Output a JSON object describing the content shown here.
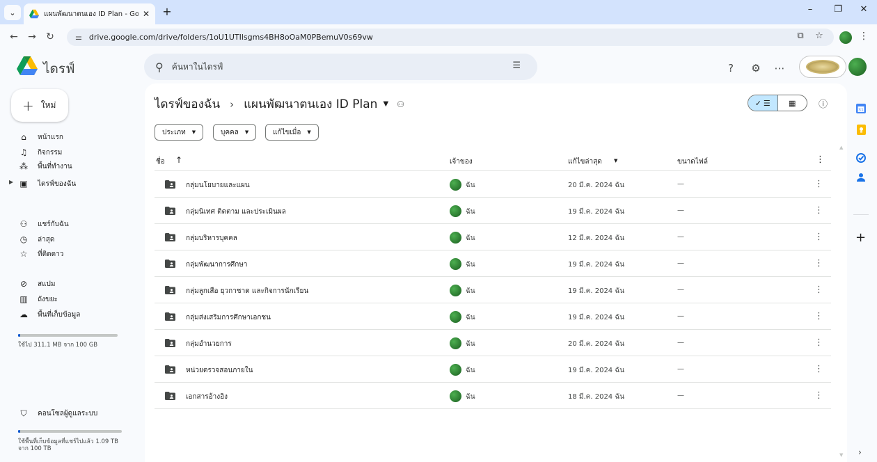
{
  "browser": {
    "tab_title": "แผนพัฒนาตนเอง ID Plan - Google",
    "url": "drive.google.com/drive/folders/1oU1UTIlsgms4BH8oOaM0PBemuV0s69vw"
  },
  "header": {
    "brand": "ไดรฟ์",
    "search_placeholder": "ค้นหาในไดรฟ์"
  },
  "sidebar": {
    "new_label": "ใหม่",
    "items": [
      {
        "label": "หน้าแรก",
        "icon": "home-icon"
      },
      {
        "label": "กิจกรรม",
        "icon": "bell-icon"
      },
      {
        "label": "พื้นที่ทำงาน",
        "icon": "workspace-icon"
      },
      {
        "label": "ไดรฟ์ของฉัน",
        "icon": "my-drive-icon"
      },
      {
        "label": "แชร์กับฉัน",
        "icon": "people-icon"
      },
      {
        "label": "ล่าสุด",
        "icon": "clock-icon"
      },
      {
        "label": "ที่ติดดาว",
        "icon": "star-icon"
      },
      {
        "label": "สแปม",
        "icon": "spam-icon"
      },
      {
        "label": "ถังขยะ",
        "icon": "trash-icon"
      },
      {
        "label": "พื้นที่เก็บข้อมูล",
        "icon": "cloud-icon"
      }
    ],
    "storage_text": "ใช้ไป 311.1 MB จาก 100 GB",
    "storage_fraction": 0.003,
    "admin_label": "คอนโซลผู้ดูแลระบบ",
    "shared_storage_text_line1": "ใช้พื้นที่เก็บข้อมูลที่แชร์ไปแล้ว 1.09 TB",
    "shared_storage_text_line2": "จาก 100 TB",
    "shared_storage_fraction": 0.011
  },
  "main": {
    "breadcrumb_root": "ไดรฟ์ของฉัน",
    "breadcrumb_current": "แผนพัฒนาตนเอง ID Plan",
    "filters": [
      "ประเภท",
      "บุคคล",
      "แก้ไขเมื่อ"
    ],
    "columns": {
      "name": "ชื่อ",
      "owner": "เจ้าของ",
      "modified": "แก้ไขล่าสุด",
      "size": "ขนาดไฟล์"
    },
    "rows": [
      {
        "name": "กลุ่มนโยบายและแผน",
        "owner": "ฉัน",
        "modified": "20 มี.ค. 2024 ฉัน",
        "size": "—"
      },
      {
        "name": "กลุ่มนิเทศ ติดตาม และประเมินผล",
        "owner": "ฉัน",
        "modified": "19 มี.ค. 2024 ฉัน",
        "size": "—"
      },
      {
        "name": "กลุ่มบริหารบุคคล",
        "owner": "ฉัน",
        "modified": "12 มี.ค. 2024 ฉัน",
        "size": "—"
      },
      {
        "name": "กลุ่มพัฒนาการศึกษา",
        "owner": "ฉัน",
        "modified": "19 มี.ค. 2024 ฉัน",
        "size": "—"
      },
      {
        "name": "กลุ่มลูกเสือ ยุวกาชาด และกิจการนักเรียน",
        "owner": "ฉัน",
        "modified": "19 มี.ค. 2024 ฉัน",
        "size": "—"
      },
      {
        "name": "กลุ่มส่งเสริมการศึกษาเอกชน",
        "owner": "ฉัน",
        "modified": "19 มี.ค. 2024 ฉัน",
        "size": "—"
      },
      {
        "name": "กลุ่มอำนวยการ",
        "owner": "ฉัน",
        "modified": "20 มี.ค. 2024 ฉัน",
        "size": "—"
      },
      {
        "name": "หน่วยตรวจสอบภายใน",
        "owner": "ฉัน",
        "modified": "19 มี.ค. 2024 ฉัน",
        "size": "—"
      },
      {
        "name": "เอกสารอ้างอิง",
        "owner": "ฉัน",
        "modified": "18 มี.ค. 2024 ฉัน",
        "size": "—"
      }
    ]
  },
  "colors": {
    "accent_blue": "#0b57d0",
    "selected_toggle": "#c2e7ff",
    "tab_strip": "#d3e3fd",
    "page_bg": "#f8fafd"
  }
}
